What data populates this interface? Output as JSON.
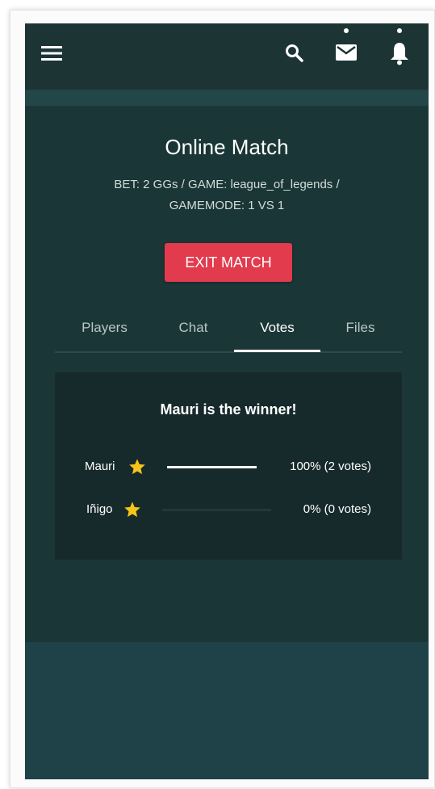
{
  "header": {
    "icons": [
      "menu-icon",
      "search-icon",
      "mail-icon",
      "bell-icon"
    ],
    "notifications": {
      "mail_dot": true,
      "bell_dot": true
    }
  },
  "match": {
    "title": "Online Match",
    "details_line1": "BET: 2 GGs / GAME: league_of_legends /",
    "details_line2": "GAMEMODE: 1 VS 1",
    "exit_label": "EXIT MATCH"
  },
  "tabs": [
    {
      "label": "Players",
      "active": false
    },
    {
      "label": "Chat",
      "active": false
    },
    {
      "label": "Votes",
      "active": true
    },
    {
      "label": "Files",
      "active": false
    }
  ],
  "votes": {
    "winner_text": "Mauri is the winner!",
    "rows": [
      {
        "name": "Mauri",
        "fraction": 1.0,
        "result": "100% (2 votes)"
      },
      {
        "name": "Iñigo",
        "fraction": 0.0,
        "result": "0% (0 votes)"
      }
    ]
  },
  "colors": {
    "accent_red": "#e23b4e",
    "background": "#1b3636",
    "star": "#f5c518"
  }
}
